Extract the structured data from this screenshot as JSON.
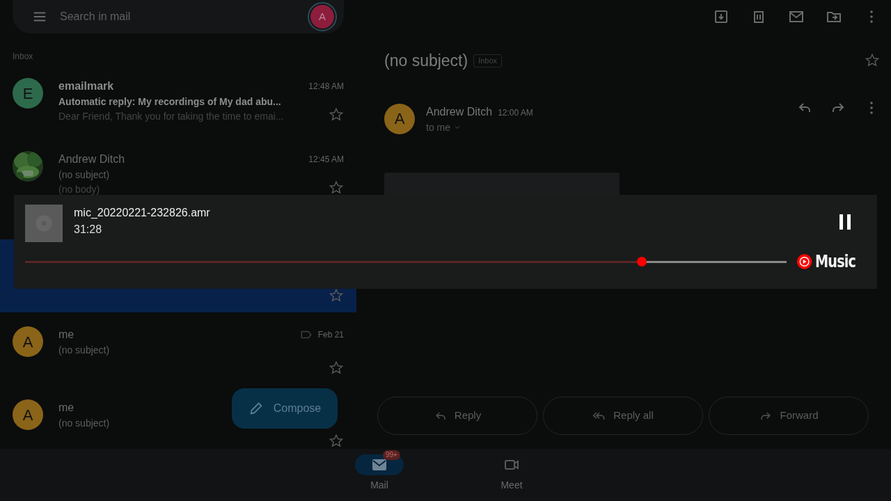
{
  "search": {
    "placeholder": "Search in mail",
    "account_initial": "A"
  },
  "folder_label": "Inbox",
  "threads": [
    {
      "sender": "emailmark",
      "time": "12:48 AM",
      "subject": "Automatic reply: My recordings of My dad abu...",
      "snippet": "Dear Friend, Thank you for taking the time to emai...",
      "avatar": {
        "kind": "letter",
        "letter": "E",
        "color": "#2d6a4c"
      },
      "unread": true,
      "selected": false
    },
    {
      "sender": "Andrew Ditch",
      "time": "12:45 AM",
      "subject": "(no subject)",
      "snippet": "(no body)",
      "unread": false,
      "selected": false
    },
    {
      "selected": true
    },
    {
      "sender": "me",
      "time": "Feb 21",
      "subject": "(no subject)",
      "avatar": {
        "kind": "letter",
        "letter": "A",
        "color": "#8a6418"
      },
      "labelled": true,
      "unread": false,
      "selected": false
    },
    {
      "sender": "me",
      "subject": "(no subject)",
      "avatar": {
        "kind": "letter",
        "letter": "A",
        "color": "#8a6418"
      },
      "unread": false,
      "selected": false
    }
  ],
  "message": {
    "subject": "(no subject)",
    "label": "Inbox",
    "sender": "Andrew Ditch",
    "time": "12:00 AM",
    "recipient": "to me",
    "avatar_initial": "A"
  },
  "actions": [
    {
      "label": "Reply",
      "kind": "reply"
    },
    {
      "label": "Reply all",
      "kind": "reply_all"
    },
    {
      "label": "Forward",
      "kind": "forward"
    }
  ],
  "player": {
    "title": "mic_20220221-232826.amr",
    "duration": "31:28",
    "level": 0.81,
    "playing": true,
    "brand": "Music"
  },
  "compose": "Compose",
  "nav": [
    {
      "label": "Mail",
      "badge": "99+",
      "kind": "mail",
      "selected": true
    },
    {
      "label": "Meet",
      "kind": "meet",
      "selected": false
    }
  ]
}
